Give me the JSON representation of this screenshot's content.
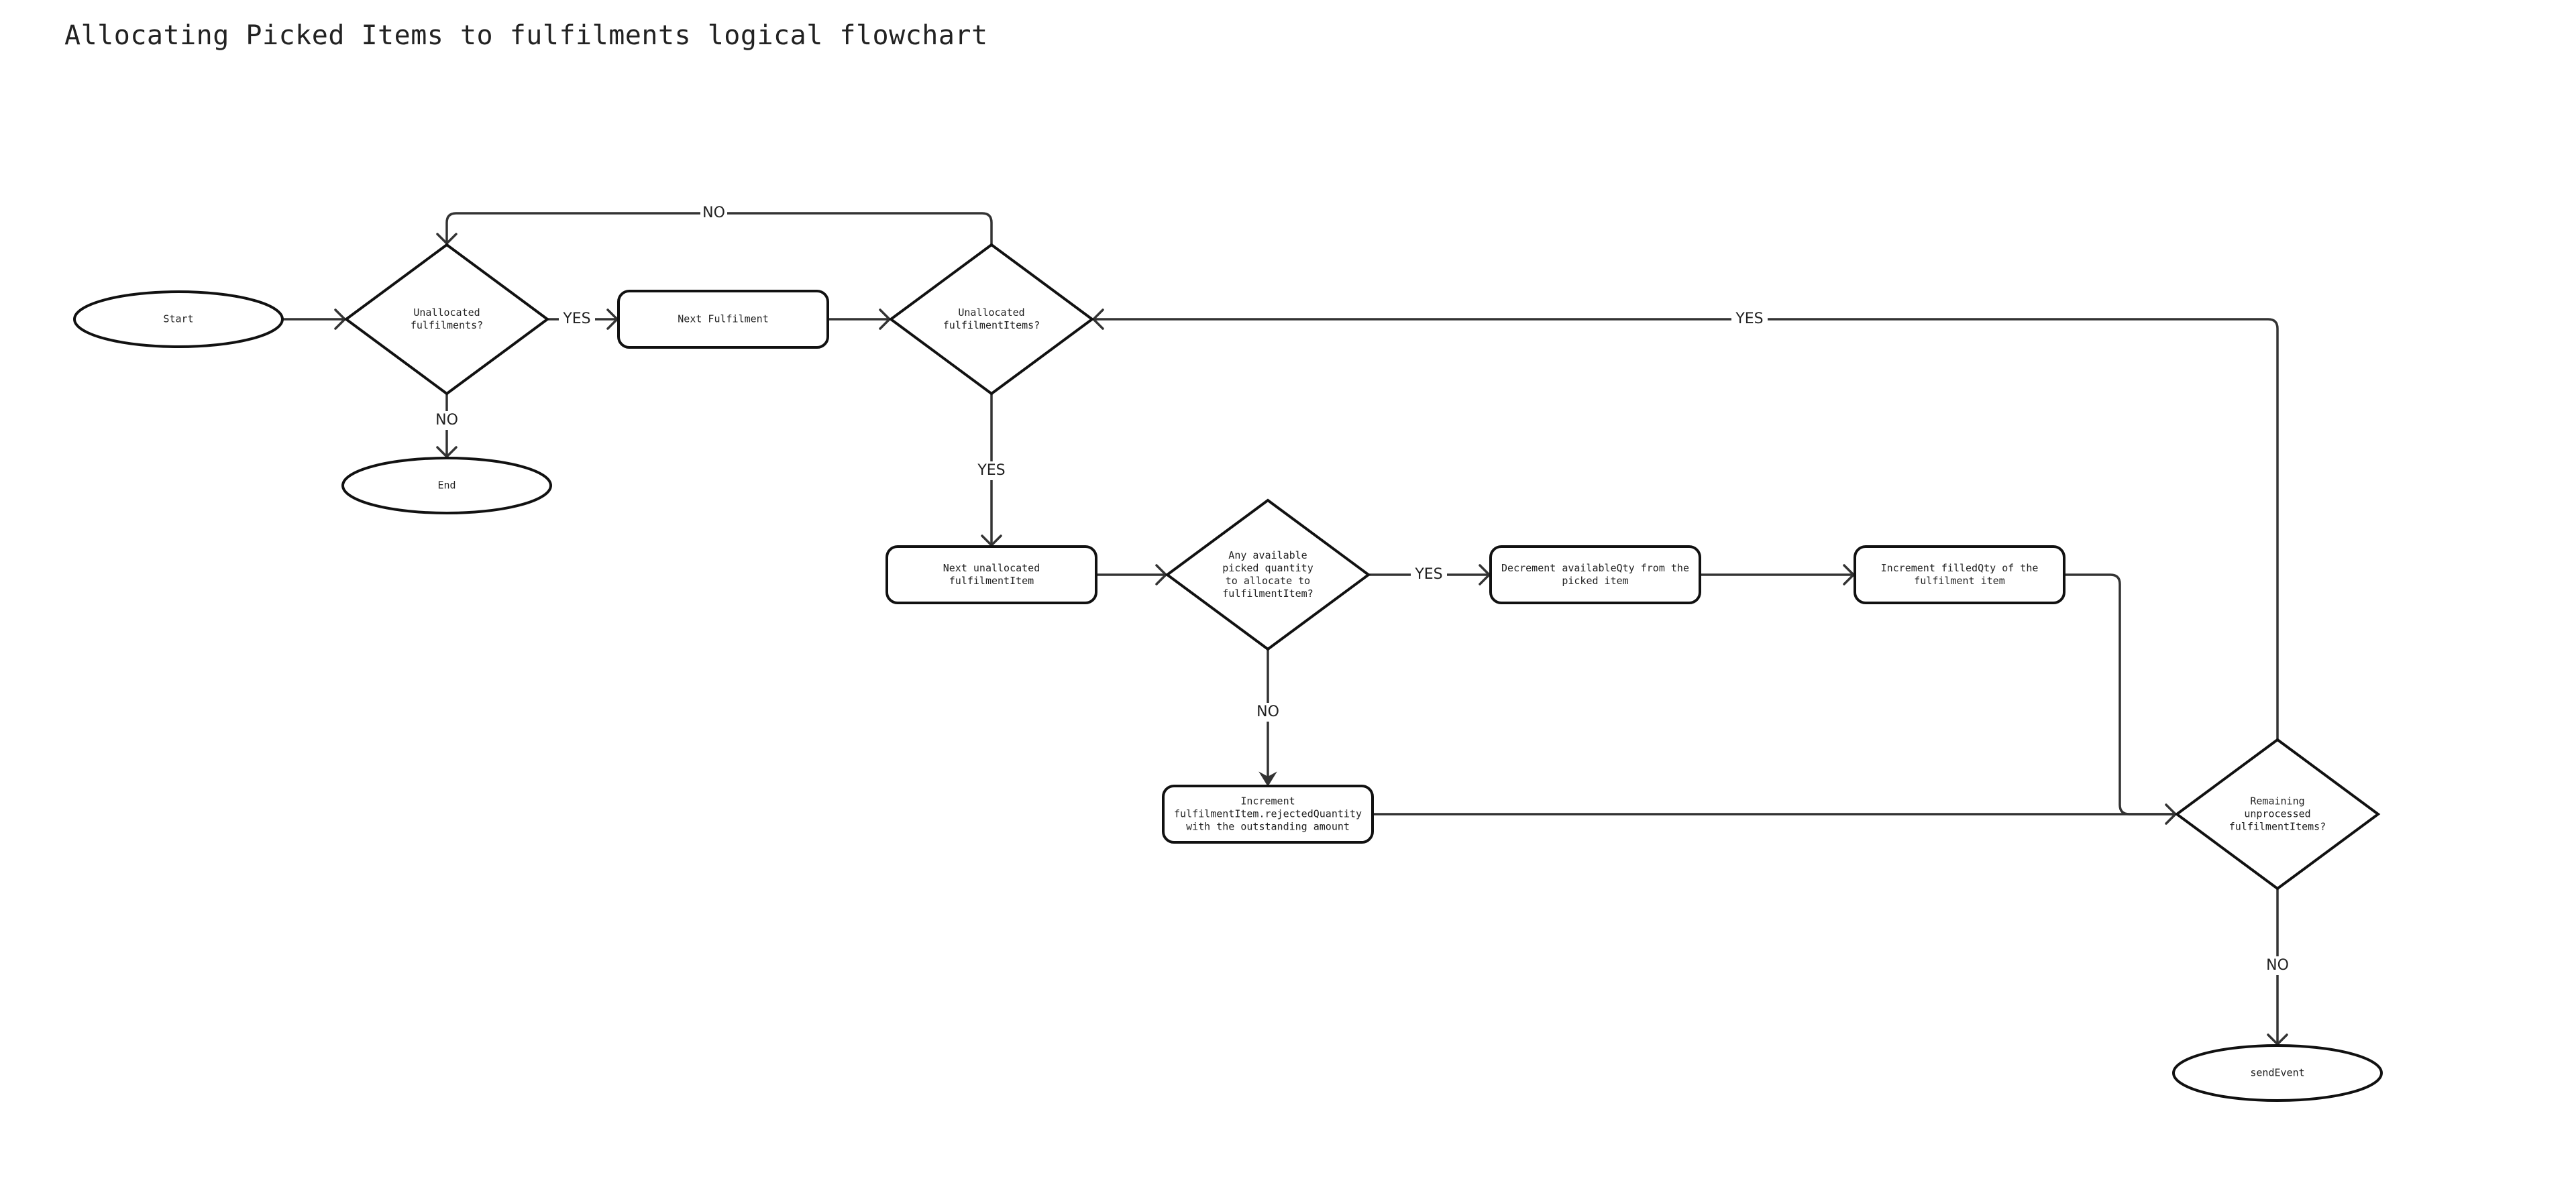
{
  "title": "Allocating Picked Items to fulfilments logical flowchart",
  "nodes": {
    "start": {
      "type": "terminal",
      "lines": [
        "Start"
      ]
    },
    "unallocated_fulfilments": {
      "type": "decision",
      "lines": [
        "Unallocated",
        "fulfilments?"
      ]
    },
    "end": {
      "type": "terminal",
      "lines": [
        "End"
      ]
    },
    "next_fulfilment": {
      "type": "process",
      "lines": [
        "Next Fulfilment"
      ]
    },
    "unallocated_items": {
      "type": "decision",
      "lines": [
        "Unallocated",
        "fulfilmentItems?"
      ]
    },
    "next_unallocated_item": {
      "type": "process",
      "lines": [
        "Next unallocated",
        "fulfilmentItem"
      ]
    },
    "any_available_qty": {
      "type": "decision",
      "lines": [
        "Any available",
        "picked quantity",
        "to allocate to",
        "fulfilmentItem?"
      ]
    },
    "decrement_available": {
      "type": "process",
      "lines": [
        "Decrement availableQty from the",
        "picked item"
      ]
    },
    "increment_filled": {
      "type": "process",
      "lines": [
        "Increment filledQty of the",
        "fulfilment item"
      ]
    },
    "increment_rejected": {
      "type": "process",
      "lines": [
        "Increment",
        "fulfilmentItem.rejectedQuantity",
        "with the outstanding amount"
      ]
    },
    "remaining_unprocessed": {
      "type": "decision",
      "lines": [
        "Remaining",
        "unprocessed",
        "fulfilmentItems?"
      ]
    },
    "send_event": {
      "type": "terminal",
      "lines": [
        "sendEvent"
      ]
    }
  },
  "edges": [
    {
      "from": "start",
      "to": "unallocated_fulfilments",
      "label": ""
    },
    {
      "from": "unallocated_fulfilments",
      "to": "next_fulfilment",
      "label": "YES"
    },
    {
      "from": "unallocated_fulfilments",
      "to": "end",
      "label": "NO"
    },
    {
      "from": "next_fulfilment",
      "to": "unallocated_items",
      "label": ""
    },
    {
      "from": "unallocated_items",
      "to": "unallocated_fulfilments",
      "label": "NO"
    },
    {
      "from": "unallocated_items",
      "to": "next_unallocated_item",
      "label": "YES"
    },
    {
      "from": "next_unallocated_item",
      "to": "any_available_qty",
      "label": ""
    },
    {
      "from": "any_available_qty",
      "to": "decrement_available",
      "label": "YES"
    },
    {
      "from": "any_available_qty",
      "to": "increment_rejected",
      "label": "NO"
    },
    {
      "from": "decrement_available",
      "to": "increment_filled",
      "label": ""
    },
    {
      "from": "increment_filled",
      "to": "remaining_unprocessed",
      "label": ""
    },
    {
      "from": "increment_rejected",
      "to": "remaining_unprocessed",
      "label": ""
    },
    {
      "from": "remaining_unprocessed",
      "to": "unallocated_items",
      "label": "YES"
    },
    {
      "from": "remaining_unprocessed",
      "to": "send_event",
      "label": "NO"
    }
  ],
  "colors": {
    "stroke": "#111111",
    "edge": "#333333",
    "text": "#222222",
    "background": "#ffffff"
  }
}
